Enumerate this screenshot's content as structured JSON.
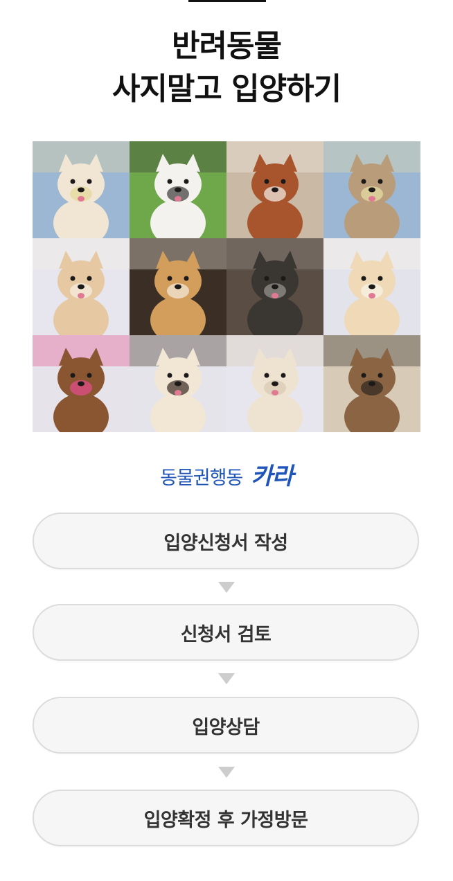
{
  "title": {
    "line1": "반려동물",
    "line2": "사지말고 입양하기"
  },
  "brand": {
    "org_name": "동물권행동",
    "logo_text": "카라",
    "color": "#1f55b8"
  },
  "photos": [
    {
      "name": "pomeranian-on-blanket",
      "bg": "#9bb7d3",
      "fur": "#f1e6d3",
      "accent": "#e4d79a"
    },
    {
      "name": "jumping-white-black-dog",
      "bg": "#6fa84a",
      "fur": "#f4f2ee",
      "accent": "#3a3a3a"
    },
    {
      "name": "border-collie-on-pavement",
      "bg": "#c9b9a5",
      "fur": "#a8552d",
      "accent": "#f5f1ea"
    },
    {
      "name": "poodle-on-blanket",
      "bg": "#9bb7d3",
      "fur": "#b99d7a",
      "accent": "#e8dfa5"
    },
    {
      "name": "cream-jindo-puppy",
      "bg": "#e7e6ee",
      "fur": "#e6c9a3",
      "accent": "#f7efe3"
    },
    {
      "name": "smiling-orange-mix",
      "bg": "#3a2e25",
      "fur": "#d39d5c",
      "accent": "#f5ede1"
    },
    {
      "name": "dark-gray-shaggy-dog",
      "bg": "#5a4d44",
      "fur": "#3a3632",
      "accent": "#9a9690"
    },
    {
      "name": "cream-small-dog",
      "bg": "#e3e3ec",
      "fur": "#efd9b7",
      "accent": "#faf3e8"
    },
    {
      "name": "brown-poodle-pink-leash",
      "bg": "#e6e4ea",
      "fur": "#8a5632",
      "accent": "#e64d8f"
    },
    {
      "name": "white-jindo-smiling",
      "bg": "#e5e4ea",
      "fur": "#f1e7d4",
      "accent": "#3a2a22"
    },
    {
      "name": "white-terrier-mix",
      "bg": "#e7e6ee",
      "fur": "#eee3d0",
      "accent": "#d8c9b2"
    },
    {
      "name": "shih-tzu-on-sofa",
      "bg": "#d7cbb8",
      "fur": "#8a6443",
      "accent": "#2f2720"
    }
  ],
  "steps": [
    {
      "label": "입양신청서 작성"
    },
    {
      "label": "신청서 검토"
    },
    {
      "label": "입양상담"
    },
    {
      "label": "입양확정 후 가정방문"
    }
  ],
  "colors": {
    "title": "#111111",
    "step_bg": "#f6f6f6",
    "step_border": "#dcdcdc",
    "arrow": "#cdcdcd"
  }
}
